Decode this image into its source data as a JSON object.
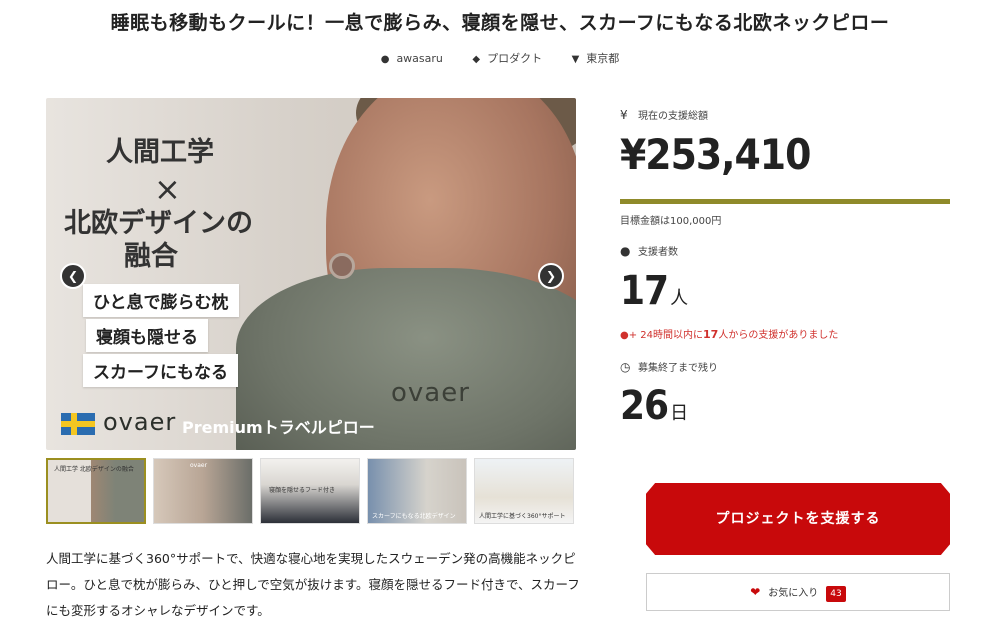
{
  "title": "睡眠も移動もクールに！一息で膨らみ、寝顔を隠せ、スカーフにもなる北欧ネックピロー",
  "meta": {
    "author": "awasaru",
    "category": "プロダクト",
    "location": "東京都",
    "author_icon": "user-icon",
    "category_icon": "tag-icon",
    "location_icon": "map-pin-icon"
  },
  "hero": {
    "line1": "人間工学",
    "cross": "×",
    "line2": "北欧デザインの",
    "line3": "融合",
    "chip1": "ひと息で膨らむ枕",
    "chip2": "寝顔も隠せる",
    "chip3": "スカーフにもなる",
    "brand": "ovaer",
    "tagline": "Premiumトラベルピロー",
    "pillow_logo": "ovaer"
  },
  "thumbnails": [
    {
      "caption": "人間工学 北欧デザインの融合"
    },
    {
      "caption": "ovaer"
    },
    {
      "caption": "寝顔を隠せるフード付き"
    },
    {
      "caption": "スカーフにもなる北欧デザイン"
    },
    {
      "caption": "人間工学に基づく360°サポート"
    }
  ],
  "description": "人間工学に基づく360°サポートで、快適な寝心地を実現したスウェーデン発の高機能ネックピロー。ひと息で枕が膨らみ、ひと押しで空気が抜けます。寝顔を隠せるフード付きで、スカーフにも変形するオシャレなデザインです。",
  "funding": {
    "total_label": "現在の支援総額",
    "total": "¥253,410",
    "goal": "目標金額は100,000円",
    "progress_percent": 100,
    "backers_label": "支援者数",
    "backers": "17",
    "backers_unit": "人",
    "recent_prefix": "24時間以内に",
    "recent_count": "17",
    "recent_suffix": "人からの支援がありました",
    "days_label": "募集終了まで残り",
    "days": "26",
    "days_unit": "日"
  },
  "actions": {
    "support_label": "プロジェクトを支援する",
    "favorite_label": "お気に入り",
    "favorite_count": "43"
  },
  "colors": {
    "accent": "#c8090b",
    "progress": "#8f8a2a"
  }
}
